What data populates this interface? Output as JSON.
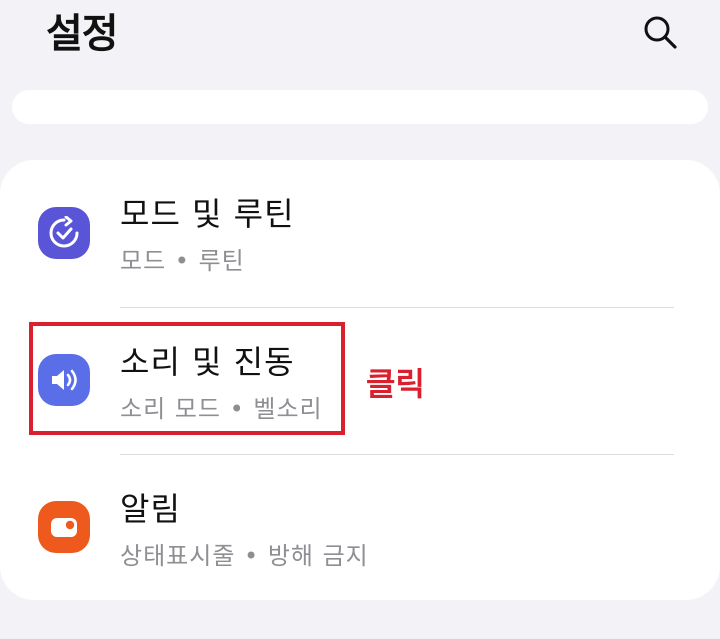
{
  "header": {
    "title": "설정",
    "search_icon": "search-icon"
  },
  "items": [
    {
      "title": "모드 및 루틴",
      "subtitle": "모드 • 루틴",
      "icon": "modes-routines-icon",
      "color": "#5a55d6"
    },
    {
      "title": "소리 및 진동",
      "subtitle": "소리 모드 • 벨소리",
      "icon": "speaker-icon",
      "color": "#5a6ee8"
    },
    {
      "title": "알림",
      "subtitle": "상태표시줄 • 방해 금지",
      "icon": "notification-icon",
      "color": "#ee5a1e"
    }
  ],
  "annotation": {
    "label": "클릭",
    "color": "#d9202e"
  }
}
